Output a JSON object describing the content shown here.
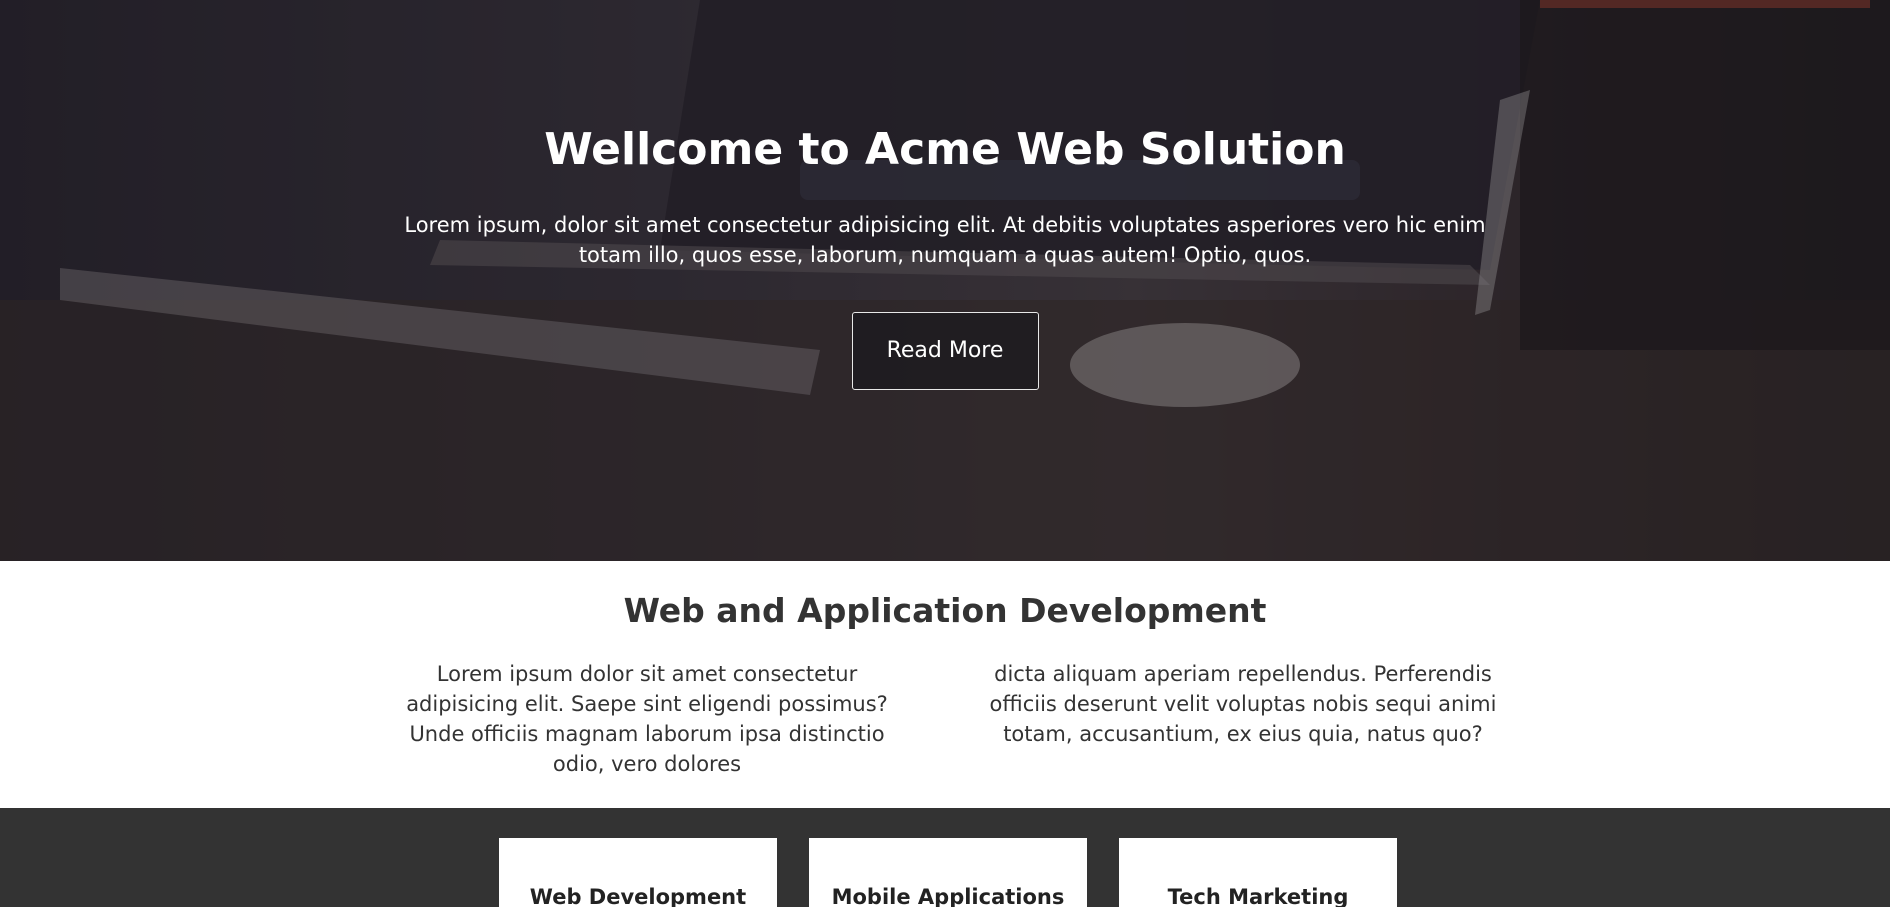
{
  "hero": {
    "title": "Wellcome to Acme Web Solution",
    "text": "Lorem ipsum, dolor sit amet consectetur adipisicing elit. At debitis voluptates asperiores vero hic enim totam illo, quos esse, laborum, numquam a quas autem! Optio, quos.",
    "button_label": "Read More"
  },
  "intro": {
    "title": "Web and Application Development",
    "columns": [
      "Lorem ipsum dolor sit amet consectetur adipisicing elit. Saepe sint eligendi possimus? Unde officiis magnam laborum ipsa distinctio odio, vero dolores",
      "dicta aliquam aperiam repellendus. Perferendis officiis deserunt velit voluptas nobis sequi animi totam, accusantium, ex eius quia, natus quo?"
    ]
  },
  "services": {
    "cards": [
      {
        "title": "Web Development"
      },
      {
        "title": "Mobile Applications"
      },
      {
        "title": "Tech Marketing"
      }
    ]
  }
}
